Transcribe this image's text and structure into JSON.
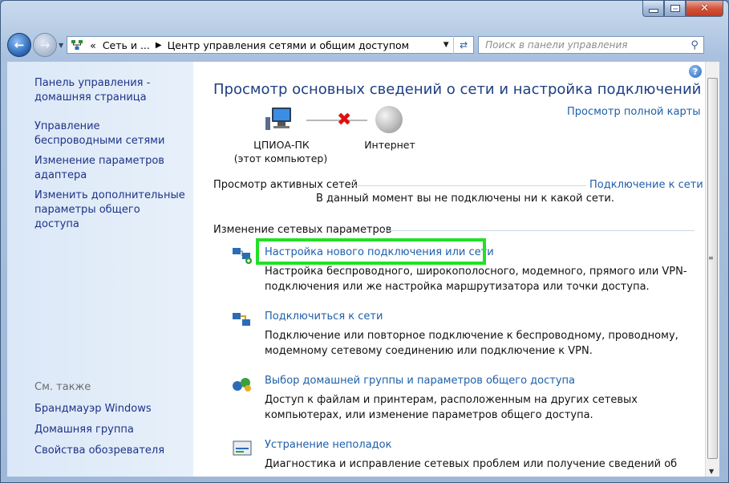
{
  "window": {
    "title_buttons": {
      "minimize": "minimize",
      "maximize": "maximize",
      "close": "✕"
    }
  },
  "navbar": {
    "address_prefix": "«",
    "breadcrumb": [
      "Сеть и ...",
      "Центр управления сетями и общим доступом"
    ],
    "search_placeholder": "Поиск в панели управления"
  },
  "sidebar": {
    "links": [
      "Панель управления - домашняя страница",
      "Управление беспроводными сетями",
      "Изменение параметров адаптера",
      "Изменить дополнительные параметры общего доступа"
    ],
    "see_also_heading": "См. также",
    "see_also": [
      "Брандмауэр Windows",
      "Домашняя группа",
      "Свойства обозревателя"
    ]
  },
  "main": {
    "title": "Просмотр основных сведений о сети и настройка подключений",
    "full_map_link": "Просмотр полной карты",
    "computer_name": "ЦПИОА-ПК",
    "computer_sub": "(этот компьютер)",
    "internet_label": "Интернет",
    "active_networks_heading": "Просмотр активных сетей",
    "connect_link": "Подключение к сети",
    "no_connection_text": "В данный момент вы не подключены ни к какой сети.",
    "change_settings_heading": "Изменение сетевых параметров",
    "tasks": [
      {
        "title": "Настройка нового подключения или сети",
        "desc": "Настройка беспроводного, широкополосного, модемного, прямого или VPN-подключения или же настройка маршрутизатора или точки доступа.",
        "icon": "new-connection-icon"
      },
      {
        "title": "Подключиться к сети",
        "desc": "Подключение или повторное подключение к беспроводному, проводному, модемному сетевому соединению или подключение к VPN.",
        "icon": "connect-network-icon"
      },
      {
        "title": "Выбор домашней группы и параметров общего доступа",
        "desc": "Доступ к файлам и принтерам, расположенным на других сетевых компьютерах, или изменение параметров общего доступа.",
        "icon": "homegroup-icon"
      },
      {
        "title": "Устранение неполадок",
        "desc": "Диагностика и исправление сетевых проблем или получение сведений об исправлении.",
        "icon": "troubleshoot-icon"
      }
    ]
  },
  "colors": {
    "highlight": "#22e027",
    "link": "#1e5fa8",
    "title": "#1e3f82"
  }
}
